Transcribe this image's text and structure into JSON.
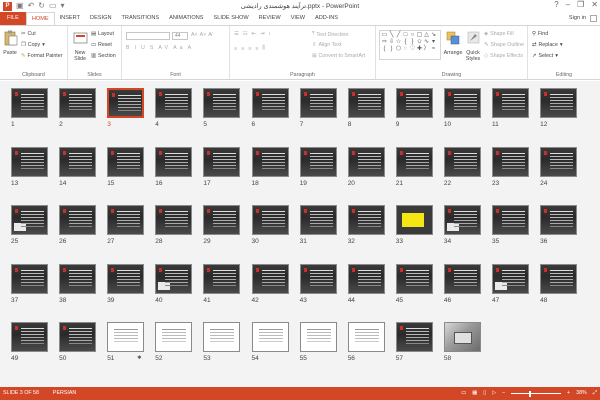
{
  "window": {
    "title": "ترآیند هوشمندی رادیشی.pptx - PowerPoint",
    "controls": [
      "?",
      "–",
      "❐",
      "✕"
    ]
  },
  "tabs": {
    "items": [
      "FILE",
      "HOME",
      "INSERT",
      "DESIGN",
      "TRANSITIONS",
      "ANIMATIONS",
      "SLIDE SHOW",
      "REVIEW",
      "VIEW",
      "ADD-INS"
    ],
    "active": "HOME",
    "sign_in": "Sign in"
  },
  "ribbon": {
    "clipboard": {
      "label": "Clipboard",
      "paste": "Paste",
      "cut": "Cut",
      "copy": "Copy",
      "format_painter": "Format Painter"
    },
    "slides": {
      "label": "Slides",
      "new_slide": "New Slide",
      "layout": "Layout",
      "reset": "Reset",
      "section": "Section"
    },
    "font": {
      "label": "Font",
      "font_name": "",
      "font_size": "44"
    },
    "paragraph": {
      "label": "Paragraph",
      "text_direction": "Text Direction",
      "align_text": "Align Text",
      "convert_smartart": "Convert to SmartArt"
    },
    "drawing": {
      "label": "Drawing",
      "arrange": "Arrange",
      "quick_styles": "Quick Styles",
      "shape_fill": "Shape Fill",
      "shape_outline": "Shape Outline",
      "shape_effects": "Shape Effects"
    },
    "editing": {
      "label": "Editing",
      "find": "Find",
      "replace": "Replace",
      "select": "Select"
    }
  },
  "sorter": {
    "selected_slide": 3,
    "slides": [
      {
        "n": "1",
        "style": "dark"
      },
      {
        "n": "2",
        "style": "dark"
      },
      {
        "n": "3",
        "style": "dark"
      },
      {
        "n": "4",
        "style": "dark"
      },
      {
        "n": "5",
        "style": "dark"
      },
      {
        "n": "6",
        "style": "dark"
      },
      {
        "n": "7",
        "style": "dark"
      },
      {
        "n": "8",
        "style": "dark"
      },
      {
        "n": "9",
        "style": "dark"
      },
      {
        "n": "10",
        "style": "dark"
      },
      {
        "n": "11",
        "style": "dark"
      },
      {
        "n": "12",
        "style": "dark"
      },
      {
        "n": "13",
        "style": "dark"
      },
      {
        "n": "14",
        "style": "dark"
      },
      {
        "n": "15",
        "style": "dark"
      },
      {
        "n": "16",
        "style": "dark"
      },
      {
        "n": "17",
        "style": "dark"
      },
      {
        "n": "18",
        "style": "dark"
      },
      {
        "n": "19",
        "style": "dark"
      },
      {
        "n": "20",
        "style": "dark"
      },
      {
        "n": "21",
        "style": "dark"
      },
      {
        "n": "22",
        "style": "dark"
      },
      {
        "n": "23",
        "style": "dark"
      },
      {
        "n": "24",
        "style": "dark"
      },
      {
        "n": "25",
        "style": "dark"
      },
      {
        "n": "26",
        "style": "dark"
      },
      {
        "n": "27",
        "style": "dark"
      },
      {
        "n": "28",
        "style": "dark"
      },
      {
        "n": "29",
        "style": "dark"
      },
      {
        "n": "30",
        "style": "dark"
      },
      {
        "n": "31",
        "style": "dark"
      },
      {
        "n": "32",
        "style": "dark"
      },
      {
        "n": "33",
        "style": "yellow"
      },
      {
        "n": "34",
        "style": "dark"
      },
      {
        "n": "35",
        "style": "dark"
      },
      {
        "n": "36",
        "style": "dark"
      },
      {
        "n": "37",
        "style": "dark"
      },
      {
        "n": "38",
        "style": "dark"
      },
      {
        "n": "39",
        "style": "dark"
      },
      {
        "n": "40",
        "style": "dark"
      },
      {
        "n": "41",
        "style": "dark"
      },
      {
        "n": "42",
        "style": "dark"
      },
      {
        "n": "43",
        "style": "dark"
      },
      {
        "n": "44",
        "style": "dark"
      },
      {
        "n": "45",
        "style": "dark"
      },
      {
        "n": "46",
        "style": "dark"
      },
      {
        "n": "47",
        "style": "dark"
      },
      {
        "n": "48",
        "style": "dark"
      },
      {
        "n": "49",
        "style": "dark"
      },
      {
        "n": "50",
        "style": "dark"
      },
      {
        "n": "51",
        "style": "white",
        "star": "✱"
      },
      {
        "n": "52",
        "style": "white"
      },
      {
        "n": "53",
        "style": "white"
      },
      {
        "n": "54",
        "style": "white"
      },
      {
        "n": "55",
        "style": "white"
      },
      {
        "n": "56",
        "style": "white"
      },
      {
        "n": "57",
        "style": "dark"
      },
      {
        "n": "58",
        "style": "photo"
      }
    ]
  },
  "status": {
    "slide_info": "SLIDE 3 OF 58",
    "language": "PERSIAN",
    "zoom_level": "38%",
    "zoom_minus": "–",
    "zoom_plus": "+",
    "zoom_fraction": 0.38
  },
  "colors": {
    "accent": "#d24726",
    "sorter_bg": "#f3f3f3"
  }
}
